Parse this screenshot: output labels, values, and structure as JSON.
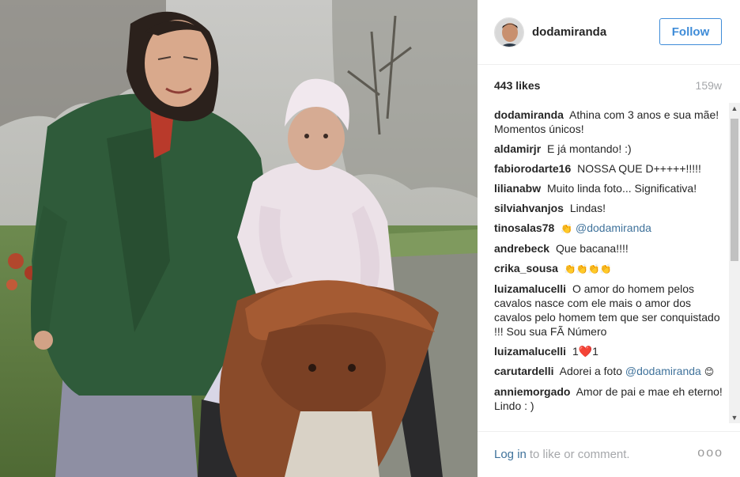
{
  "post": {
    "username": "dodamiranda",
    "follow_label": "Follow",
    "likes": "443 likes",
    "age": "159w"
  },
  "comments": [
    {
      "user": "dodamiranda",
      "text": "Athina com 3 anos e sua mãe! Momentos únicos!"
    },
    {
      "user": "aldamirjr",
      "text": "E já montando! :)"
    },
    {
      "user": "fabiorodarte16",
      "text": "NOSSA QUE D+++++!!!!!"
    },
    {
      "user": "lilianabw",
      "text": "Muito linda foto... Significativa!"
    },
    {
      "user": "silviahvanjos",
      "text": "Lindas!"
    },
    {
      "user": "tinosalas78",
      "text": "👏",
      "mention": "@dodamiranda"
    },
    {
      "user": "andrebeck",
      "text": "Que bacana!!!!"
    },
    {
      "user": "crika_sousa",
      "text": "👏👏👏👏"
    },
    {
      "user": "luizamalucelli",
      "text": "O amor do homem pelos cavalos nasce com ele mais o amor dos cavalos pelo homem tem que ser conquistado !!! Sou sua FÃ Número"
    },
    {
      "user": "luizamalucelli",
      "text": "1❤️1"
    },
    {
      "user": "carutardelli",
      "text": "Adorei a foto",
      "mention": "@dodamiranda",
      "after": "😊"
    },
    {
      "user": "anniemorgado",
      "text": "Amor de pai e mae eh eterno! Lindo : )"
    }
  ],
  "footer": {
    "login_label": "Log in",
    "rest_label": "to like or comment.",
    "more_label": "ooo"
  },
  "colors": {
    "link": "#3f729b",
    "follow": "#3f8cd8",
    "muted": "#a5a7aa"
  }
}
